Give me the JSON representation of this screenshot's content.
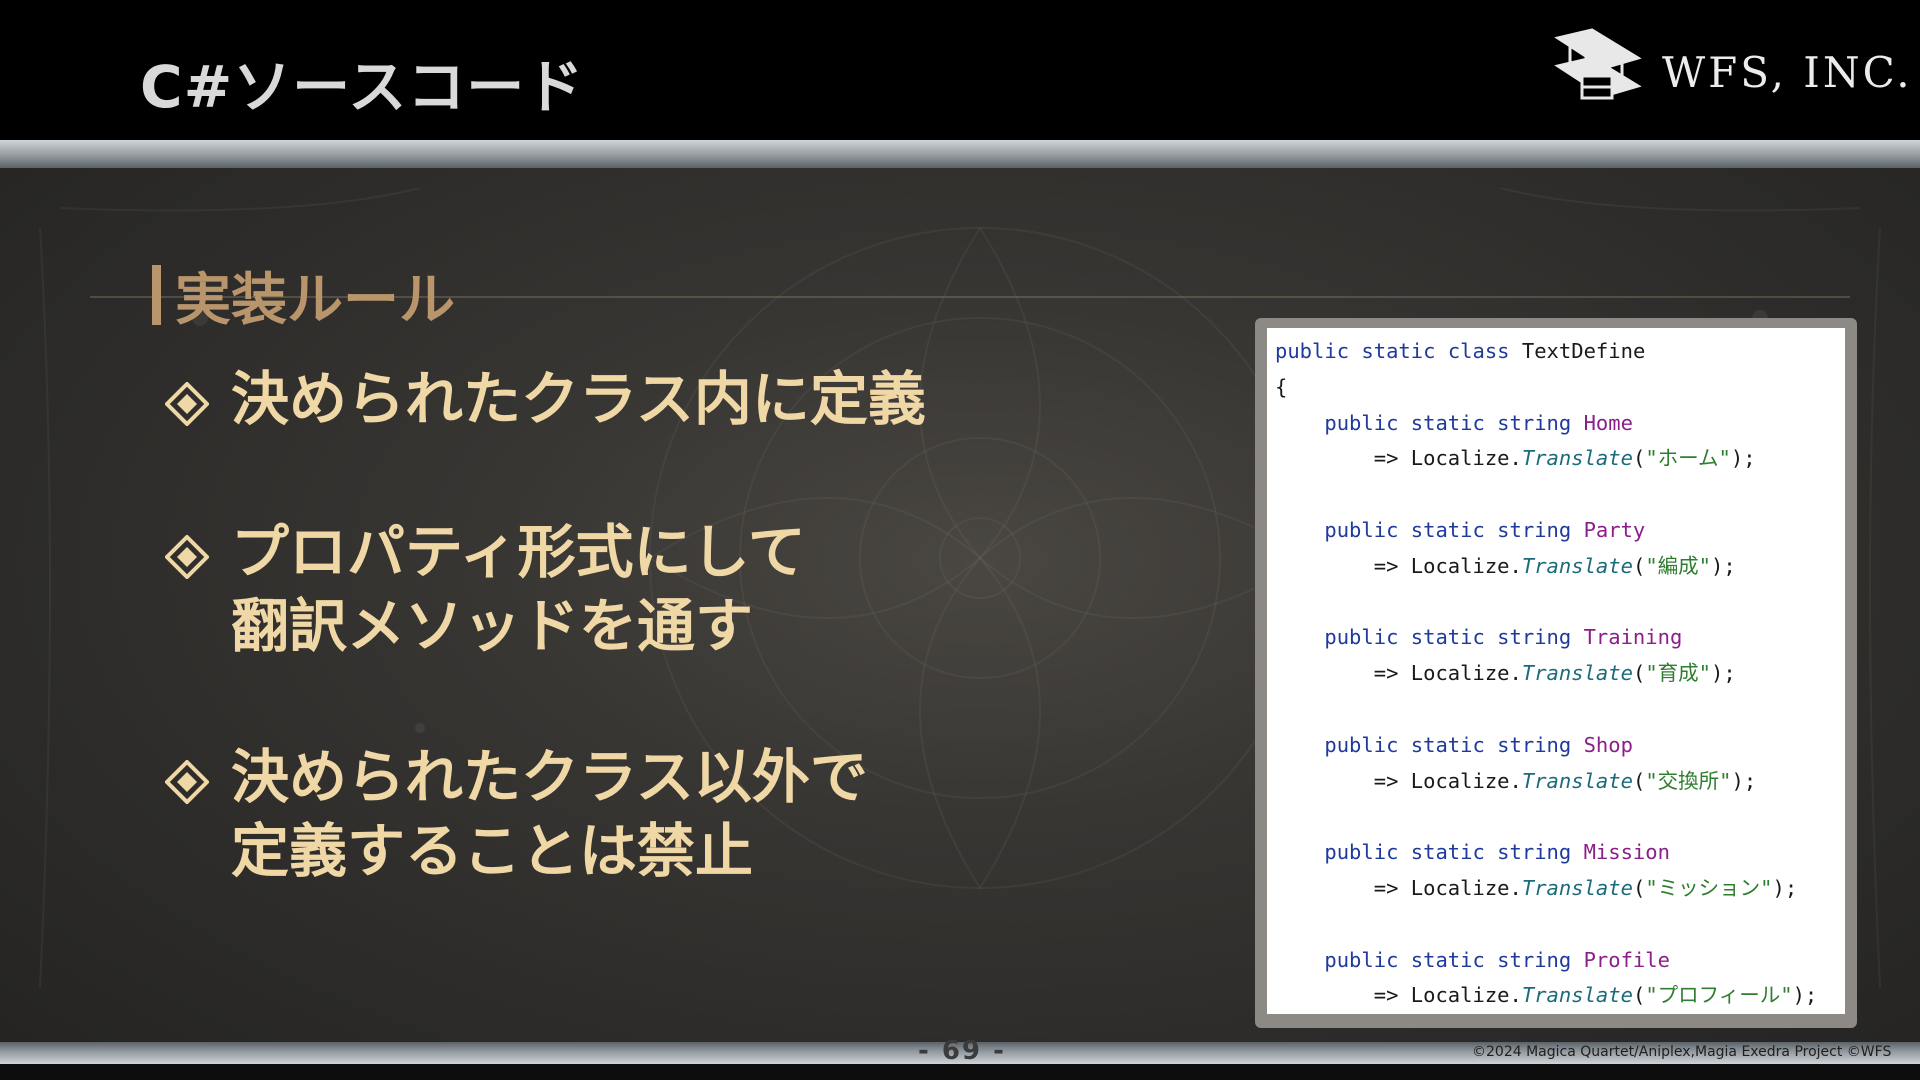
{
  "header": {
    "title": "C#ソースコード",
    "logo_text": "WFS, INC."
  },
  "section": {
    "heading": "実装ルール"
  },
  "bullets": [
    {
      "lines": [
        "決められたクラス内に定義"
      ]
    },
    {
      "lines": [
        "プロパティ形式にして",
        "翻訳メソッドを通す"
      ]
    },
    {
      "lines": [
        "決められたクラス以外で",
        "定義することは禁止"
      ]
    }
  ],
  "code": {
    "class_decl": {
      "k1": "public",
      "k2": "static",
      "k3": "class",
      "name": "TextDefine"
    },
    "open_brace": "{",
    "arrow": "=>",
    "receiver": "Localize.",
    "method": "Translate",
    "props": [
      {
        "name": "Home",
        "value": "\"ホーム\""
      },
      {
        "name": "Party",
        "value": "\"編成\""
      },
      {
        "name": "Training",
        "value": "\"育成\""
      },
      {
        "name": "Shop",
        "value": "\"交換所\""
      },
      {
        "name": "Mission",
        "value": "\"ミッション\""
      },
      {
        "name": "Profile",
        "value": "\"プロフィール\""
      }
    ],
    "prop_keywords": "public static string"
  },
  "footer": {
    "page_number": "- 69 -",
    "copyright": "©2024 Magica Quartet/Aniplex,Magia Exedra Project ©WFS"
  },
  "colors": {
    "heading": "#b8956a",
    "bullet_text": "#efd7a6",
    "keyword": "#1f3a9c",
    "property": "#8a1e8a",
    "string": "#2f7d2f"
  }
}
